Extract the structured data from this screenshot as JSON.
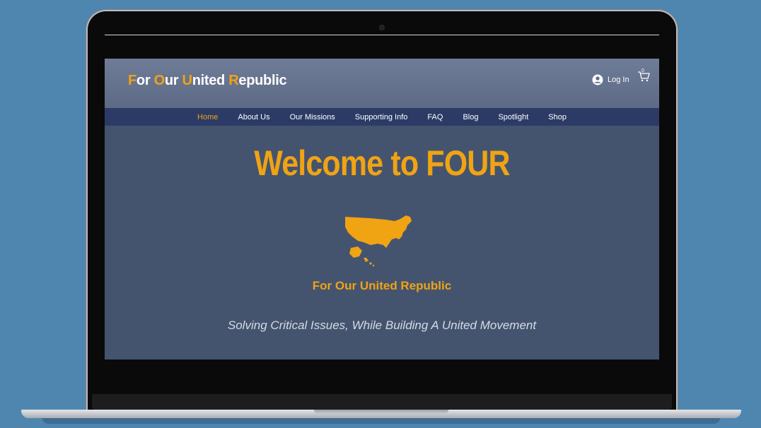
{
  "logo": {
    "parts": [
      {
        "letter": "F",
        "rest": "or "
      },
      {
        "letter": "O",
        "rest": "ur "
      },
      {
        "letter": "U",
        "rest": "nited "
      },
      {
        "letter": "R",
        "rest": "epublic"
      }
    ]
  },
  "header": {
    "login_label": "Log In",
    "cart_count": "0"
  },
  "nav": {
    "items": [
      "Home",
      "About Us",
      "Our Missions",
      "Supporting Info",
      "FAQ",
      "Blog",
      "Spotlight",
      "Shop"
    ],
    "active": "Home"
  },
  "hero": {
    "title": "Welcome to FOUR",
    "tagline": "For Our United Republic",
    "subtitle": "Solving Critical Issues, While Building A United Movement"
  },
  "colors": {
    "accent": "#f0a313",
    "nav_bg": "#2c3b66",
    "page_bg": "#44546f",
    "backdrop": "#4f86b0"
  },
  "icons": [
    "user-icon",
    "cart-icon",
    "usa-map-icon"
  ]
}
